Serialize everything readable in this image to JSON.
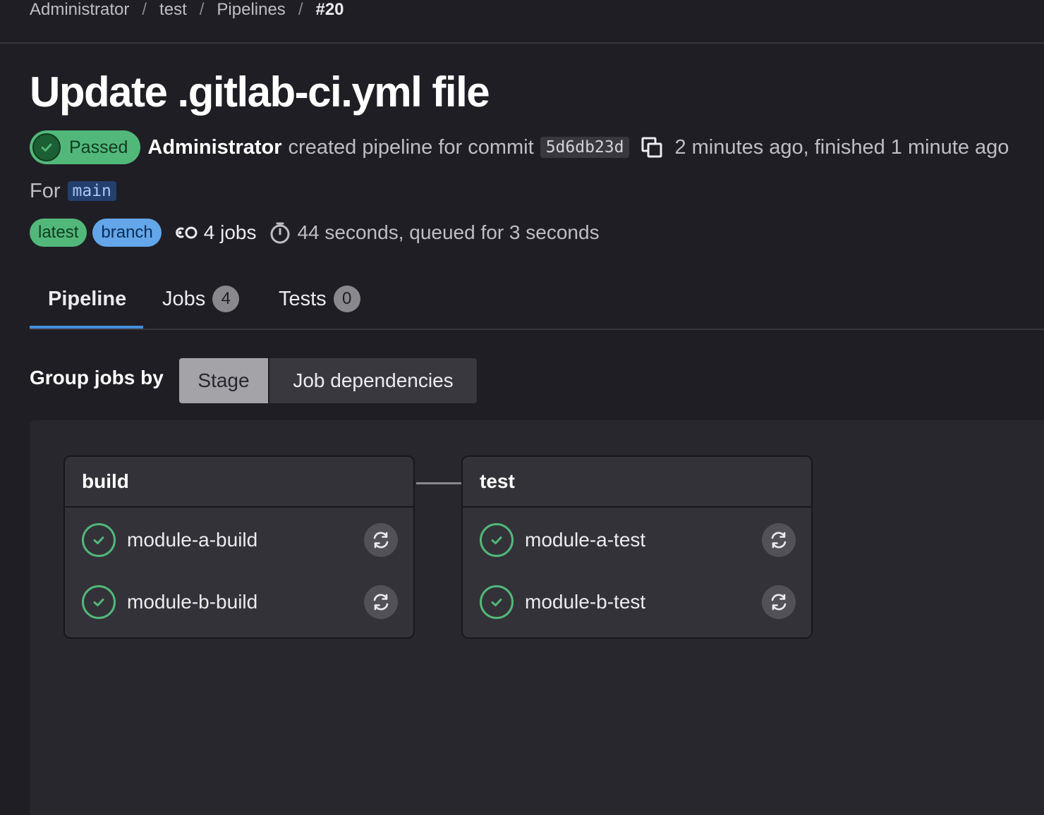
{
  "breadcrumb": {
    "items": [
      "Administrator",
      "test",
      "Pipelines"
    ],
    "current": "#20",
    "separator": "/"
  },
  "pipeline": {
    "title": "Update .gitlab-ci.yml file",
    "status": "Passed",
    "author": "Administrator",
    "action_text": "created pipeline for commit",
    "commit_sha": "5d6db23d",
    "time_text": "2 minutes ago, finished 1 minute ago",
    "for_label": "For",
    "ref": "main",
    "badges": {
      "latest": "latest",
      "branch": "branch"
    },
    "jobs_count": "4 jobs",
    "duration": "44 seconds, queued for 3 seconds"
  },
  "tabs": [
    {
      "label": "Pipeline",
      "active": true
    },
    {
      "label": "Jobs",
      "count": "4"
    },
    {
      "label": "Tests",
      "count": "0"
    }
  ],
  "grouping": {
    "label": "Group jobs by",
    "options": [
      "Stage",
      "Job dependencies"
    ],
    "selected": "Stage"
  },
  "stages": [
    {
      "name": "build",
      "jobs": [
        {
          "name": "module-a-build",
          "status": "success"
        },
        {
          "name": "module-b-build",
          "status": "success"
        }
      ]
    },
    {
      "name": "test",
      "jobs": [
        {
          "name": "module-a-test",
          "status": "success"
        },
        {
          "name": "module-b-test",
          "status": "success"
        }
      ]
    }
  ],
  "icons": [
    "check-circle-icon",
    "copy-icon",
    "jobs-icon",
    "timer-icon",
    "retry-icon"
  ],
  "colors": {
    "success": "#52b87a",
    "link": "#428fdc",
    "background": "#1f1e24"
  }
}
